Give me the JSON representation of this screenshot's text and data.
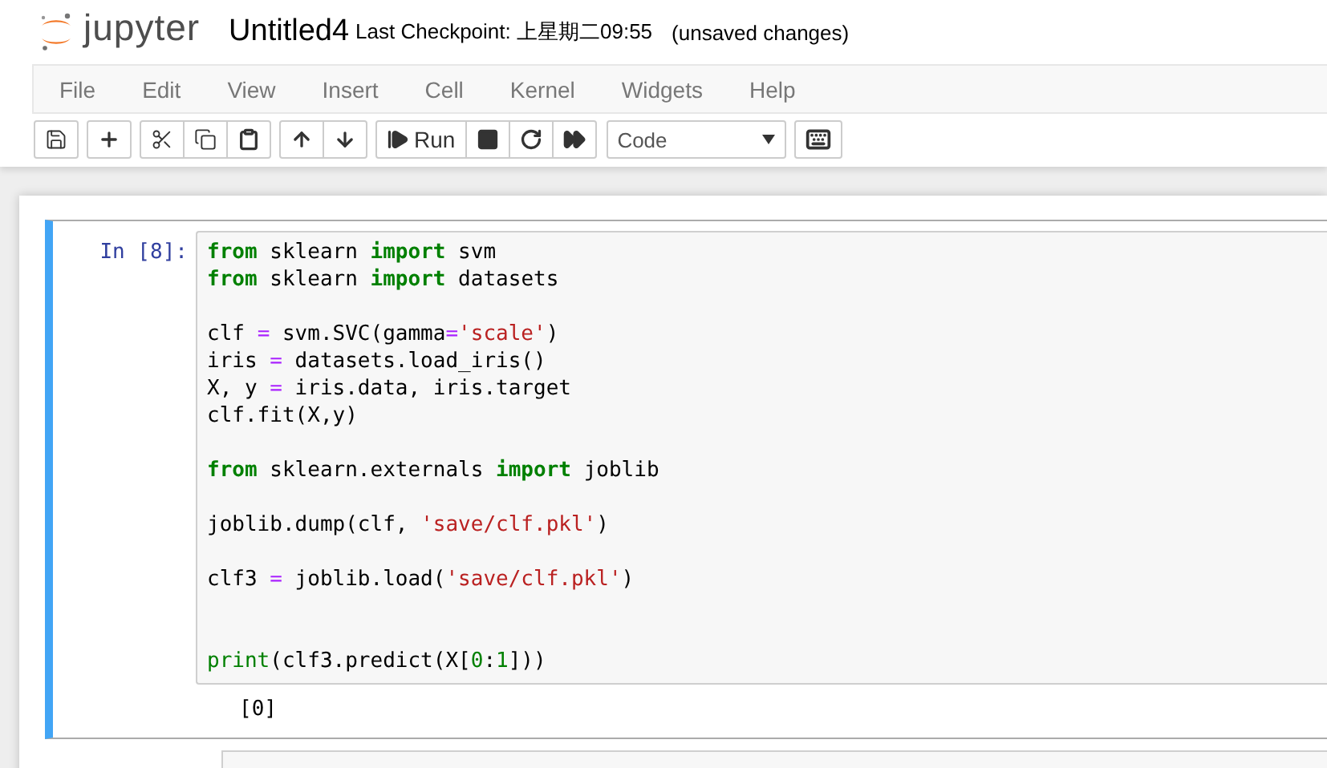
{
  "header": {
    "logo_text": "jupyter",
    "notebook_name": "Untitled4",
    "checkpoint": "Last Checkpoint: 上星期二09:55",
    "status": "(unsaved changes)"
  },
  "menu": [
    "File",
    "Edit",
    "View",
    "Insert",
    "Cell",
    "Kernel",
    "Widgets",
    "Help"
  ],
  "toolbar": [
    {
      "buttons": [
        {
          "kind": "save"
        }
      ]
    },
    {
      "buttons": [
        {
          "kind": "insert"
        }
      ]
    },
    {
      "buttons": [
        {
          "kind": "cut"
        },
        {
          "kind": "copy"
        },
        {
          "kind": "paste"
        }
      ]
    },
    {
      "buttons": [
        {
          "kind": "up"
        },
        {
          "kind": "down"
        }
      ]
    },
    {
      "buttons": [
        {
          "kind": "run",
          "label": "Run"
        },
        {
          "kind": "stop"
        },
        {
          "kind": "restart"
        },
        {
          "kind": "run-all"
        }
      ]
    },
    {
      "buttons": [
        {
          "kind": "cell-type",
          "label": "Code"
        }
      ]
    },
    {
      "buttons": [
        {
          "kind": "keyboard"
        }
      ]
    }
  ],
  "cell": {
    "prompt": "In [8]:",
    "selected": true,
    "output": "[0]",
    "code": [
      {
        "kind": "tight",
        "tokens": [
          {
            "kind": "kw",
            "t": "from"
          },
          {
            "kind": "plain",
            "t": " sklearn "
          },
          {
            "kind": "kw",
            "t": "import"
          },
          {
            "kind": "plain",
            "t": " svm"
          }
        ]
      },
      {
        "kind": "tight",
        "tokens": [
          {
            "kind": "kw",
            "t": "from"
          },
          {
            "kind": "plain",
            "t": " sklearn "
          },
          {
            "kind": "kw",
            "t": "import"
          },
          {
            "kind": "plain",
            "t": " datasets"
          }
        ]
      },
      {
        "kind": "spaced",
        "tokens": [
          {
            "kind": "plain",
            "t": "clf "
          },
          {
            "kind": "op",
            "t": "="
          },
          {
            "kind": "plain",
            "t": " svm.SVC(gamma"
          },
          {
            "kind": "op",
            "t": "="
          },
          {
            "kind": "str",
            "t": "'scale'"
          },
          {
            "kind": "plain",
            "t": ")"
          }
        ]
      },
      {
        "kind": "tight",
        "tokens": [
          {
            "kind": "plain",
            "t": "iris "
          },
          {
            "kind": "op",
            "t": "="
          },
          {
            "kind": "plain",
            "t": " datasets.load_iris()"
          }
        ]
      },
      {
        "kind": "tight",
        "tokens": [
          {
            "kind": "plain",
            "t": "X, y "
          },
          {
            "kind": "op",
            "t": "="
          },
          {
            "kind": "plain",
            "t": " iris.data, iris.target"
          }
        ]
      },
      {
        "kind": "tight",
        "tokens": [
          {
            "kind": "plain",
            "t": "clf.fit(X,y)"
          }
        ]
      },
      {
        "kind": "spaced",
        "tokens": [
          {
            "kind": "kw",
            "t": "from"
          },
          {
            "kind": "plain",
            "t": " sklearn.externals "
          },
          {
            "kind": "kw",
            "t": "import"
          },
          {
            "kind": "plain",
            "t": " joblib"
          }
        ]
      },
      {
        "kind": "spaced",
        "tokens": [
          {
            "kind": "plain",
            "t": "joblib.dump(clf, "
          },
          {
            "kind": "str",
            "t": "'save/clf.pkl'"
          },
          {
            "kind": "plain",
            "t": ")"
          }
        ]
      },
      {
        "kind": "spaced",
        "tokens": [
          {
            "kind": "plain",
            "t": "clf3 "
          },
          {
            "kind": "op",
            "t": "="
          },
          {
            "kind": "plain",
            "t": " joblib.load("
          },
          {
            "kind": "str",
            "t": "'save/clf.pkl'"
          },
          {
            "kind": "plain",
            "t": ")"
          }
        ]
      },
      {
        "kind": "gapped",
        "tokens": [
          {
            "kind": "builtin",
            "t": "print"
          },
          {
            "kind": "plain",
            "t": "(clf3.predict(X["
          },
          {
            "kind": "num",
            "t": "0"
          },
          {
            "kind": "plain",
            "t": ":"
          },
          {
            "kind": "num",
            "t": "1"
          },
          {
            "kind": "plain",
            "t": "]))"
          }
        ]
      }
    ]
  }
}
